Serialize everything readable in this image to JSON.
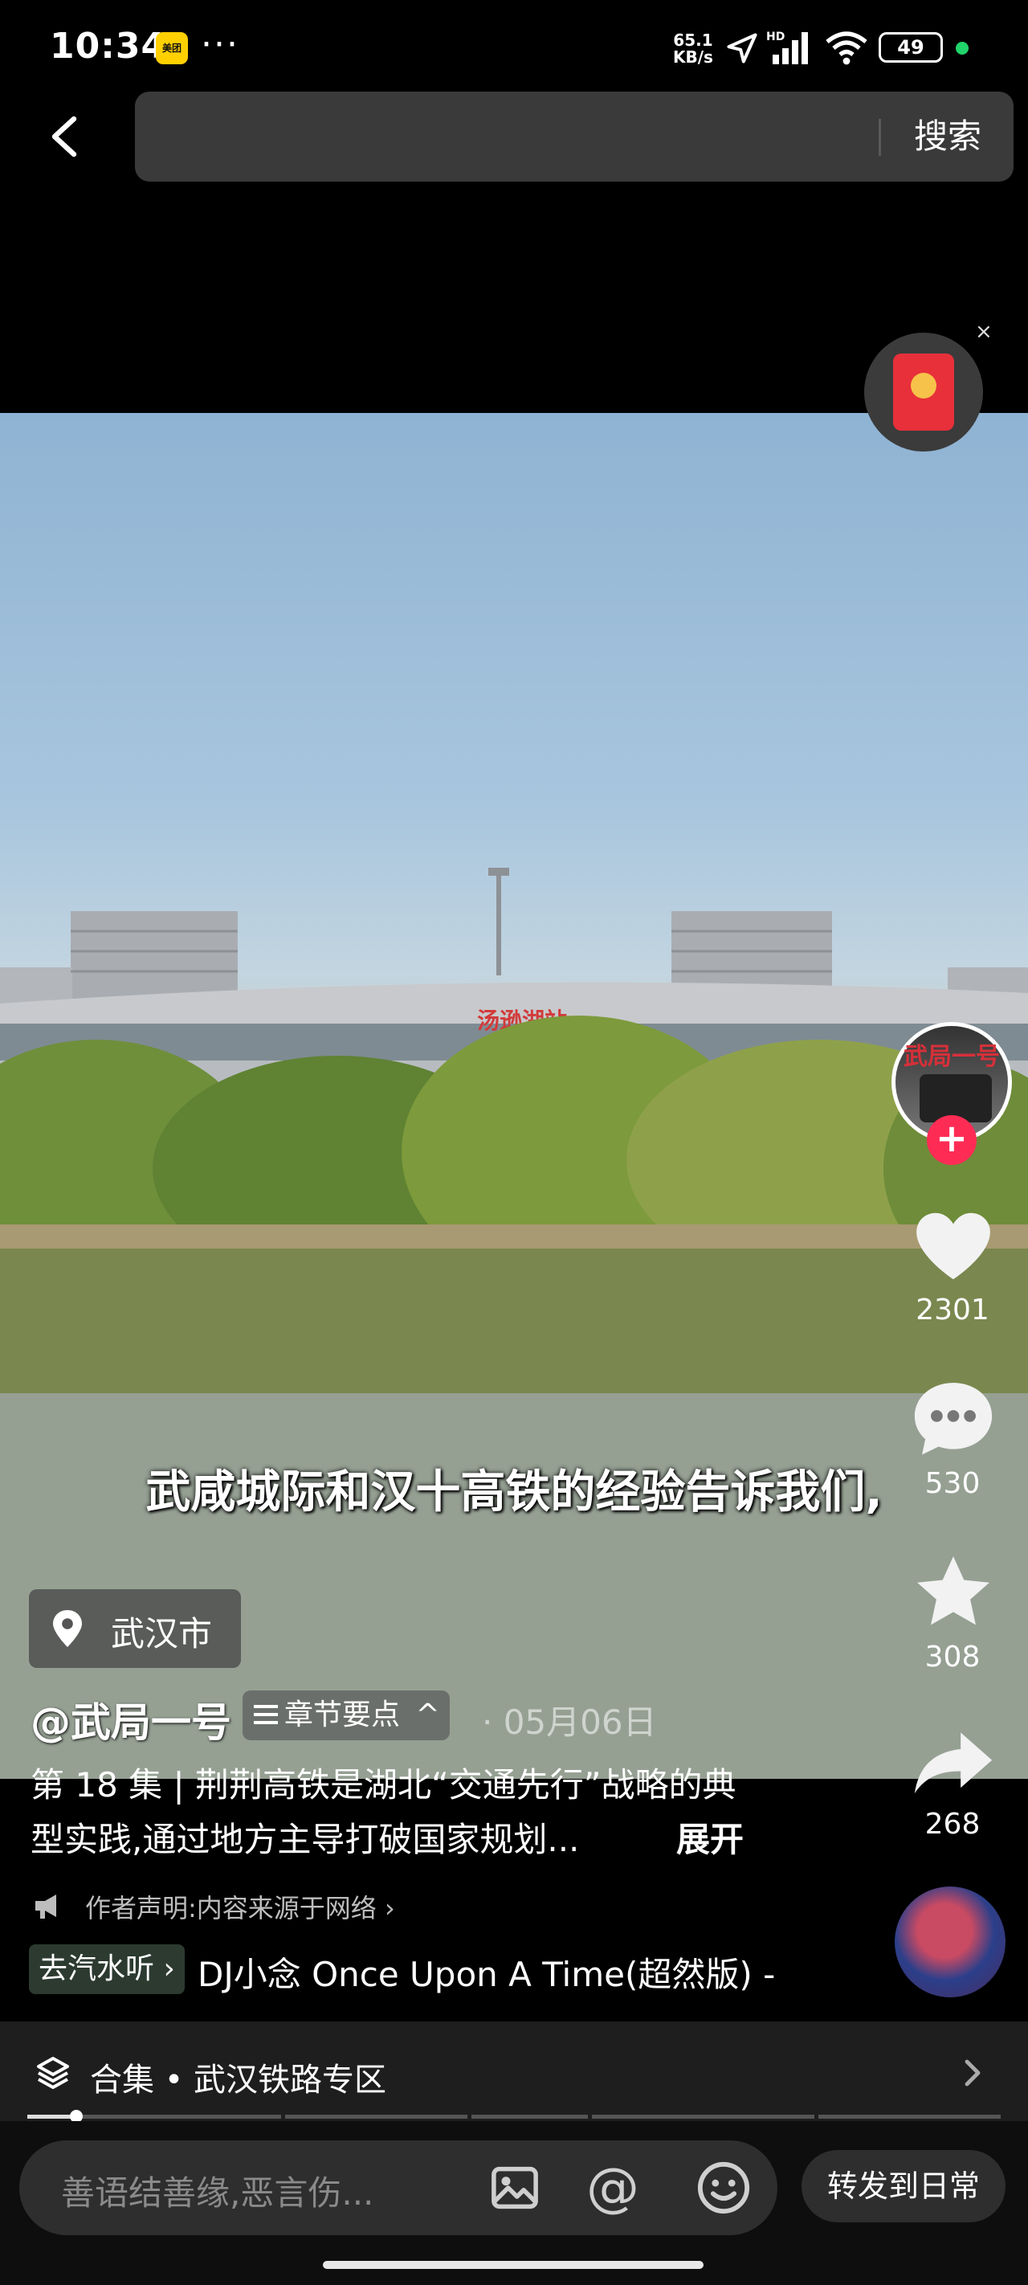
{
  "status_bar": {
    "time": "10:34",
    "app_badge": "美团",
    "more": "···",
    "net_speed_value": "65.1",
    "net_speed_unit": "KB/s",
    "battery": "49"
  },
  "header": {
    "search_button": "搜索"
  },
  "video": {
    "station_sign": "汤逊湖站",
    "subtitle": "武咸城际和汉十高铁的经验告诉我们,"
  },
  "location": {
    "city": "武汉市"
  },
  "post": {
    "author": "@武局一号",
    "chapter_label": "章节要点",
    "date": "· 05月06日",
    "description_line1": "第 18 集 | 荆荆高铁是湖北“交通先行”战略的典",
    "description_line2": "型实践,通过地方主导打破国家规划...",
    "expand_label": "展开",
    "declaration": "作者声明:内容来源于网络 ›"
  },
  "music": {
    "qishui_label": "去汽水听",
    "title": "DJ小念    Once Upon A Time(超然版) -"
  },
  "sidebar": {
    "avatar_text": "武局一号",
    "follow": "+",
    "likes": "2301",
    "comments": "530",
    "favorites": "308",
    "shares": "268"
  },
  "collection": {
    "label": "合集 • 武汉铁路专区",
    "progress": 0.05
  },
  "bottom": {
    "comment_placeholder": "善语结善缘,恶言伤...",
    "share_daily": "转发到日常"
  },
  "colors": {
    "accent_red": "#fe2c55",
    "background": "#000000"
  }
}
